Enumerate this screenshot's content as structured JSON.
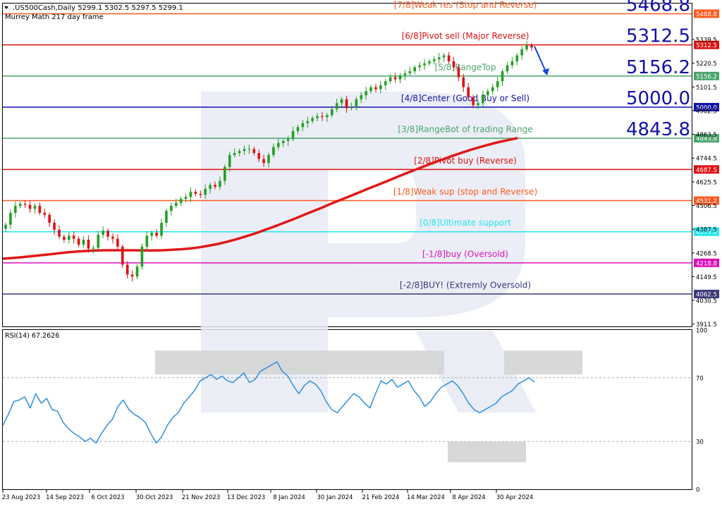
{
  "header": {
    "symbol_line": ".US500Cash,Daily  5299.1 5302.5 5297.5 5299.1",
    "indicator_line": "Murrey Math 217 day frame"
  },
  "rsi_label": "RSI(14) 67.2626",
  "colors": {
    "bull": "#22a022",
    "bear": "#dd1111",
    "ma": "#e01818",
    "rsi": "#2f8fe0",
    "arrow": "#1144dd"
  },
  "chart_data": [
    {
      "type": "line",
      "title": "",
      "ylim": [
        3900,
        5520
      ],
      "x_tick_labels": [
        "23 Aug 2023",
        "14 Sep 2023",
        "6 Oct 2023",
        "30 Oct 2023",
        "21 Nov 2023",
        "13 Dec 2023",
        "8 Jan 2024",
        "30 Jan 2024",
        "21 Feb 2024",
        "14 Mar 2024",
        "8 Apr 2024",
        "30 Apr 2024"
      ],
      "y_tick_labels": [
        "5339.5",
        "5220.5",
        "5101.5",
        "4982.5",
        "4863.5",
        "4744.5",
        "4625.5",
        "4506.5",
        "4387.5",
        "4268.5",
        "4149.5",
        "4030.5",
        "3911.5"
      ],
      "levels": [
        {
          "value": 5468.8,
          "big": "5468.8",
          "tag": "5468.8",
          "label": "[7/8]Weak res (Stop and Reverse)",
          "line_color": "#ff5a1f",
          "text_color": "#ff5a1f",
          "tag_bg": "#ff5a1f"
        },
        {
          "value": 5312.5,
          "big": "5312.5",
          "tag": "5312.5",
          "label": "[6/8]Pivot sell (Major Reverse)",
          "line_color": "#dd1111",
          "text_color": "#dd1111",
          "tag_bg": "#dd1111"
        },
        {
          "value": 5156.2,
          "big": "5156.2",
          "tag": "5156.2",
          "label": "[5/8]RangeTop",
          "line_color": "#4aa56d",
          "text_color": "#4aa56d",
          "tag_bg": "#4aa56d"
        },
        {
          "value": 5000.0,
          "big": "5000.0",
          "tag": "5000.0",
          "label": "[4/8]Center (Good Buy or Sell)",
          "line_color": "#1111aa",
          "text_color": "#1111aa",
          "tag_bg": "#1111aa"
        },
        {
          "value": 4843.8,
          "big": "4843.8",
          "tag": "4843.8",
          "label": "[3/8]RangeBot of trading Range",
          "line_color": "#4aa56d",
          "text_color": "#4aa56d",
          "tag_bg": "#4aa56d"
        },
        {
          "value": 4687.5,
          "big": "",
          "tag": "4687.5",
          "label": "[2/8]Pivot buy (Reverse)",
          "line_color": "#dd1111",
          "text_color": "#dd1111",
          "tag_bg": "#dd1111"
        },
        {
          "value": 4531.2,
          "big": "",
          "tag": "4531.2",
          "label": "[1/8]Weak sup (stop and Reverse)",
          "line_color": "#ff5a1f",
          "text_color": "#ff5a1f",
          "tag_bg": "#ff5a1f"
        },
        {
          "value": 4375.0,
          "big": "",
          "tag": "4375.0",
          "label": "[0/8]Ultimate support",
          "line_color": "#22e6ee",
          "text_color": "#22e6ee",
          "tag_bg": "#22e6ee"
        },
        {
          "value": 4218.8,
          "big": "",
          "tag": "4218.8",
          "label": "[-1/8]buy (Oversold)",
          "line_color": "#dd11bb",
          "text_color": "#dd11bb",
          "tag_bg": "#dd11bb"
        },
        {
          "value": 4062.5,
          "big": "",
          "tag": "4062.5",
          "label": "[-2/8]BUY! (Extremly Oversold)",
          "line_color": "#3a3a7a",
          "text_color": "#3a3a7a",
          "tag_bg": "#3a3a7a"
        }
      ],
      "series": [
        {
          "kind": "candles",
          "values": [
            4410,
            4470,
            4505,
            4515,
            4510,
            4490,
            4505,
            4470,
            4460,
            4420,
            4385,
            4350,
            4335,
            4355,
            4340,
            4310,
            4335,
            4290,
            4295,
            4360,
            4380,
            4350,
            4340,
            4300,
            4210,
            4160,
            4150,
            4200,
            4300,
            4355,
            4370,
            4355,
            4420,
            4480,
            4505,
            4520,
            4540,
            4550,
            4575,
            4565,
            4560,
            4590,
            4610,
            4600,
            4630,
            4700,
            4760,
            4770,
            4780,
            4790,
            4790,
            4770,
            4740,
            4720,
            4760,
            4800,
            4820,
            4830,
            4840,
            4880,
            4900,
            4920,
            4930,
            4945,
            4955,
            4950,
            4960,
            4990,
            5020,
            5040,
            4995,
            5000,
            5040,
            5060,
            5080,
            5100,
            5090,
            5110,
            5130,
            5150,
            5140,
            5160,
            5170,
            5180,
            5200,
            5210,
            5220,
            5230,
            5240,
            5250,
            5260,
            5230,
            5200,
            5150,
            5100,
            5050,
            5010,
            5020,
            5060,
            5080,
            5100,
            5130,
            5180,
            5210,
            5230,
            5260,
            5290,
            5310,
            5299.1
          ]
        },
        {
          "kind": "ma",
          "name": "",
          "values": [
            4240,
            4243,
            4247,
            4252,
            4257,
            4262,
            4267,
            4272,
            4276,
            4279,
            4281,
            4282,
            4282,
            4282,
            4282,
            4281,
            4281,
            4282,
            4284,
            4287,
            4291,
            4297,
            4305,
            4314,
            4325,
            4338,
            4352,
            4367,
            4384,
            4401,
            4419,
            4437,
            4456,
            4475,
            4494,
            4514,
            4533,
            4552,
            4571,
            4590,
            4609,
            4628,
            4647,
            4666,
            4685,
            4703,
            4721,
            4738,
            4755,
            4771,
            4786,
            4800,
            4813,
            4825,
            4835,
            4845
          ]
        },
        {
          "kind": "arrow",
          "name": "",
          "values": [
            5312.5,
            5156.2
          ]
        }
      ]
    },
    {
      "type": "line",
      "title": "RSI(14) 67.2626",
      "ylim": [
        0,
        100
      ],
      "y_tick_labels": [
        "100",
        "70",
        "30",
        "0"
      ],
      "levels": [
        70,
        30
      ],
      "series": [
        {
          "name": "RSI(14)",
          "values": [
            40,
            47,
            55,
            56,
            58,
            51,
            60,
            54,
            57,
            50,
            49,
            42,
            38,
            35,
            33,
            30,
            32,
            29,
            35,
            40,
            44,
            52,
            56,
            50,
            47,
            45,
            42,
            35,
            29,
            33,
            40,
            45,
            48,
            54,
            58,
            62,
            68,
            70,
            72,
            69,
            71,
            68,
            67,
            70,
            73,
            67,
            69,
            74,
            76,
            78,
            80,
            74,
            71,
            65,
            60,
            65,
            68,
            66,
            62,
            55,
            50,
            48,
            52,
            56,
            60,
            58,
            54,
            51,
            60,
            68,
            66,
            69,
            64,
            66,
            68,
            62,
            58,
            52,
            55,
            60,
            64,
            66,
            68,
            65,
            60,
            54,
            50,
            48,
            50,
            52,
            54,
            58,
            60,
            62,
            66,
            68,
            70,
            67.26
          ]
        }
      ]
    }
  ]
}
